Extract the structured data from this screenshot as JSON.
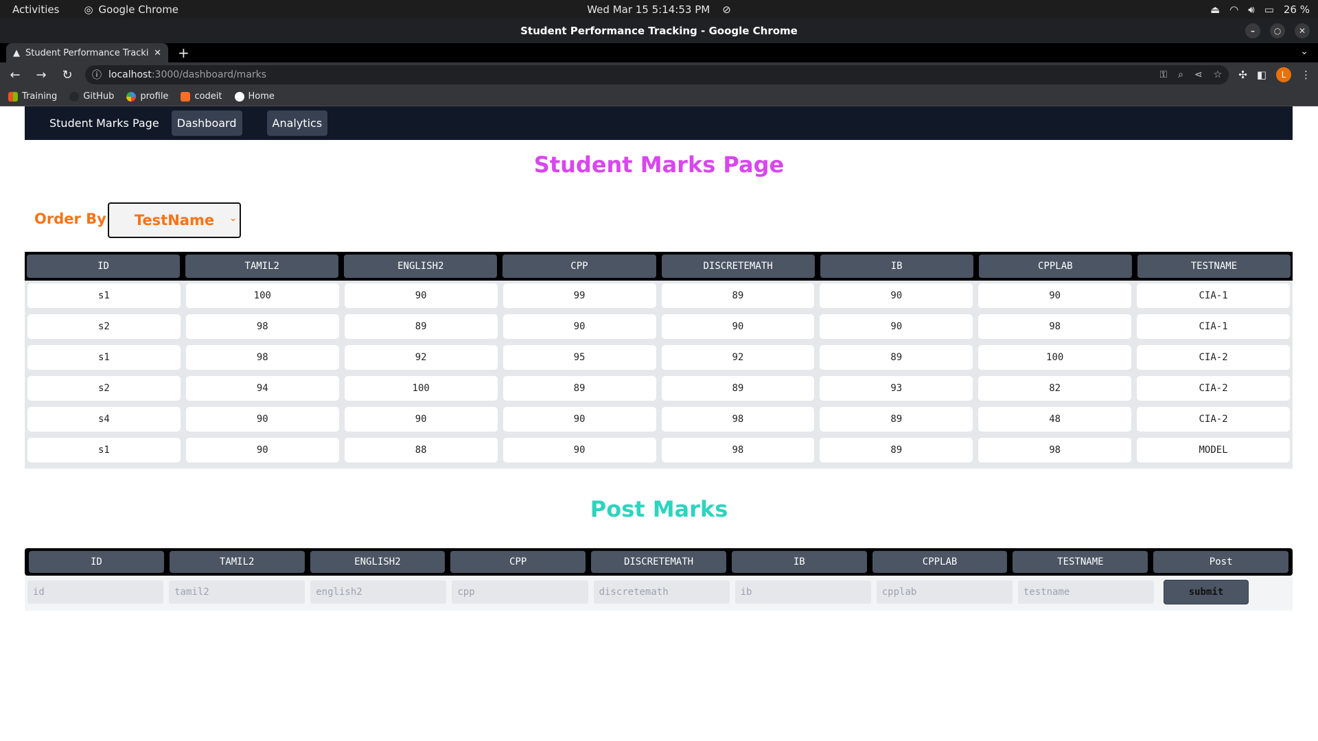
{
  "os": {
    "activities": "Activities",
    "app_name": "Google Chrome",
    "clock": "Wed Mar 15  5:14:53 PM",
    "battery": "26 %"
  },
  "window": {
    "title": "Student Performance Tracking - Google Chrome"
  },
  "tabs": [
    {
      "title": "Student Performance Tracking"
    }
  ],
  "toolbar": {
    "url_host": "localhost",
    "url_path": ":3000/dashboard/marks",
    "profile_initial": "L"
  },
  "bookmarks": [
    {
      "label": "Training",
      "icon": "grid-icon",
      "color": "#f25022"
    },
    {
      "label": "GitHub",
      "icon": "github-icon",
      "color": "#24292e"
    },
    {
      "label": "profile",
      "icon": "pinwheel-icon",
      "color": "#4285f4"
    },
    {
      "label": "codeit",
      "icon": "gitlab-icon",
      "color": "#fc6d26"
    },
    {
      "label": "Home",
      "icon": "home-icon",
      "color": "#111111"
    }
  ],
  "nav": {
    "brand": "Student Marks Page",
    "links": [
      "Dashboard",
      "Analytics"
    ]
  },
  "page": {
    "title": "Student Marks Page",
    "order_label": "Order By",
    "order_value": "TestName",
    "post_title": "Post Marks",
    "submit_label": "submit"
  },
  "marks_table": {
    "headers": [
      "ID",
      "TAMIL2",
      "ENGLISH2",
      "CPP",
      "DISCRETEMATH",
      "IB",
      "CPPLAB",
      "TESTNAME"
    ],
    "rows": [
      [
        "s1",
        "100",
        "90",
        "99",
        "89",
        "90",
        "90",
        "CIA-1"
      ],
      [
        "s2",
        "98",
        "89",
        "90",
        "90",
        "90",
        "98",
        "CIA-1"
      ],
      [
        "s1",
        "98",
        "92",
        "95",
        "92",
        "89",
        "100",
        "CIA-2"
      ],
      [
        "s2",
        "94",
        "100",
        "89",
        "89",
        "93",
        "82",
        "CIA-2"
      ],
      [
        "s4",
        "90",
        "90",
        "90",
        "98",
        "89",
        "48",
        "CIA-2"
      ],
      [
        "s1",
        "90",
        "88",
        "90",
        "98",
        "89",
        "98",
        "MODEL"
      ]
    ]
  },
  "post_table": {
    "headers": [
      "ID",
      "TAMIL2",
      "ENGLISH2",
      "CPP",
      "DISCRETEMATH",
      "IB",
      "CPPLAB",
      "TESTNAME",
      "Post"
    ],
    "placeholders": [
      "id",
      "tamil2",
      "english2",
      "cpp",
      "discretemath",
      "ib",
      "cpplab",
      "testname"
    ]
  },
  "colors": {
    "title": "#d946ef",
    "order": "#f97316",
    "post_title": "#2dd4bf",
    "navbar": "#111827"
  }
}
